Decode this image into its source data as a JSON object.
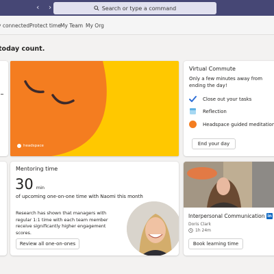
{
  "search": {
    "placeholder": "Search or type a command"
  },
  "tabs": [
    {
      "label": "y connected"
    },
    {
      "label": "Protect time"
    },
    {
      "label": "My Team"
    },
    {
      "label": "My Org"
    }
  ],
  "heading": "today count.",
  "headspace": {
    "logo_text": "headspace"
  },
  "virtual_commute": {
    "title": "Virtual Commute",
    "description": "Only a few minutes away from ending the day!",
    "items": [
      {
        "label": "Close out your tasks",
        "icon": "check-icon"
      },
      {
        "label": "Reflection",
        "icon": "reflection-icon"
      },
      {
        "label": "Headspace guided meditation",
        "icon": "headspace-dot-icon"
      }
    ],
    "button": "End your day"
  },
  "mentoring": {
    "title": "Mentoring time",
    "value": "30",
    "unit": "min",
    "subtitle": "of upcoming one-on-one time with Naomi this month",
    "body": "Research has shown that managers with regular 1:1 time with each team member receive significantly higher engagement scores.",
    "button": "Review all one-on-ones"
  },
  "course": {
    "title": "Interpersonal Communication",
    "author": "Doris Clark",
    "duration": "1h 24m",
    "provider_badge": "in",
    "button": "Book learning time"
  },
  "colors": {
    "titlebar": "#464775",
    "headspace_yellow": "#ffc800",
    "headspace_orange": "#f47d20",
    "accent": "#6264a7"
  }
}
